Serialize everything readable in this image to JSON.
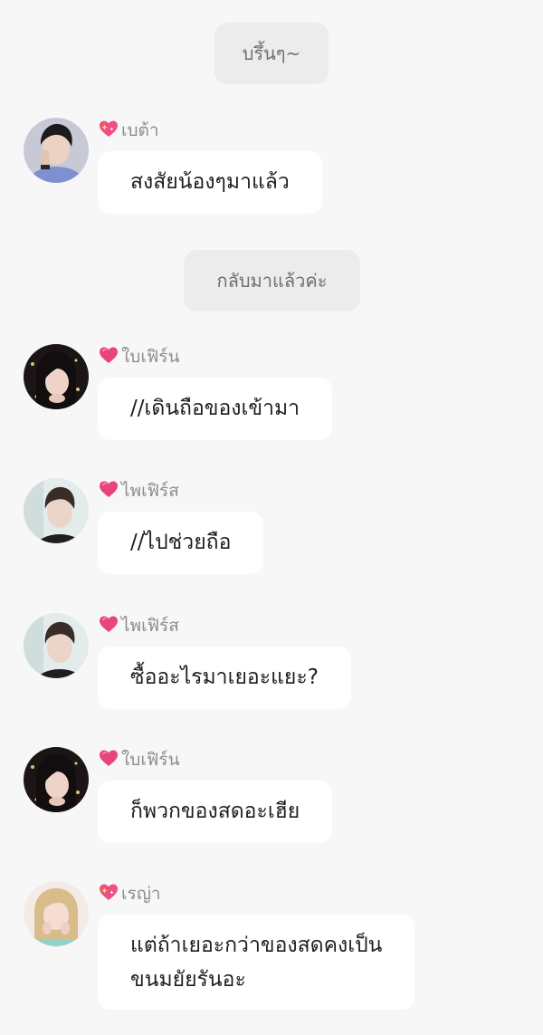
{
  "system_messages": [
    "บรึ้นๆ~",
    "กลับมาแล้วค่ะ"
  ],
  "messages": [
    {
      "sender": "เบต้า",
      "heart": "sparkling-heart-icon",
      "avatar": "boy-hand-on-face",
      "text": "สงสัยน้องๆมาแล้ว"
    },
    {
      "sender": "ใบเฟิร์น",
      "heart": "pink-heart-icon",
      "avatar": "girl-dark-hair",
      "text": "//เดินถือของเข้ามา"
    },
    {
      "sender": "ไพเฟิร์ส",
      "heart": "pink-heart-icon",
      "avatar": "boy-light-background",
      "text": "//ไปช่วยถือ"
    },
    {
      "sender": "ไพเฟิร์ส",
      "heart": "pink-heart-icon",
      "avatar": "boy-light-background",
      "text": "ซื้ออะไรมาเยอะแยะ?"
    },
    {
      "sender": "ใบเฟิร์น",
      "heart": "pink-heart-icon",
      "avatar": "girl-dark-hair",
      "text": "ก็พวกของสดอะเฮีย"
    },
    {
      "sender": "เรญ่า",
      "heart": "sparkling-heart-icon",
      "avatar": "girl-blonde-hair",
      "text": "แต่ถ้าเยอะกว่าของสดคงเป็น",
      "text2": "ขนมยัยรันอะ"
    }
  ],
  "colors": {
    "background": "#f7f7f7",
    "system_bubble": "#ececec",
    "message_bubble": "#ffffff",
    "heart_pink": "#e8467a"
  }
}
